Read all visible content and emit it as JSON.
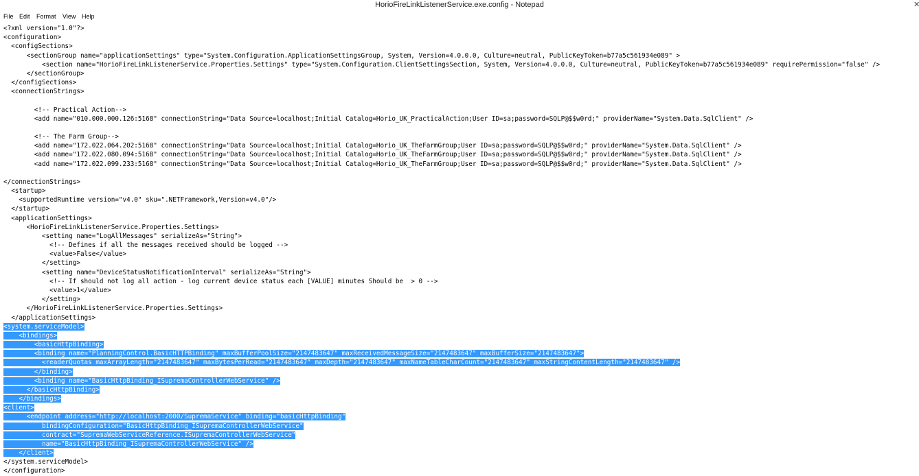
{
  "window": {
    "title": "HorioFireLinkListenerService.exe.config - Notepad"
  },
  "menu": {
    "file": "File",
    "edit": "Edit",
    "format": "Format",
    "view": "View",
    "help": "Help"
  },
  "editor": {
    "selection_color": "#3399ff",
    "lines": [
      "<?xml version=\"1.0\"?>",
      "<configuration>",
      "  <configSections>",
      "      <sectionGroup name=\"applicationSettings\" type=\"System.Configuration.ApplicationSettingsGroup, System, Version=4.0.0.0, Culture=neutral, PublicKeyToken=b77a5c561934e089\" >",
      "          <section name=\"HorioFireLinkListenerService.Properties.Settings\" type=\"System.Configuration.ClientSettingsSection, System, Version=4.0.0.0, Culture=neutral, PublicKeyToken=b77a5c561934e089\" requirePermission=\"false\" />",
      "      </sectionGroup>",
      "  </configSections>",
      "  <connectionStrings>",
      "",
      "        <!-- Practical Action-->",
      "        <add name=\"010.000.000.126:5168\" connectionString=\"Data Source=localhost;Initial Catalog=Horio_UK_PracticalAction;User ID=sa;password=SQLP@$$w0rd;\" providerName=\"System.Data.SqlClient\" />",
      "",
      "        <!-- The Farm Group-->",
      "        <add name=\"172.022.064.202:5168\" connectionString=\"Data Source=localhost;Initial Catalog=Horio_UK_TheFarmGroup;User ID=sa;password=SQLP@$$w0rd;\" providerName=\"System.Data.SqlClient\" />",
      "        <add name=\"172.022.080.094:5168\" connectionString=\"Data Source=localhost;Initial Catalog=Horio_UK_TheFarmGroup;User ID=sa;password=SQLP@$$w0rd;\" providerName=\"System.Data.SqlClient\" />",
      "        <add name=\"172.022.099.233:5168\" connectionString=\"Data Source=localhost;Initial Catalog=Horio_UK_TheFarmGroup;User ID=sa;password=SQLP@$$w0rd;\" providerName=\"System.Data.SqlClient\" />",
      "",
      "</connectionStrings>",
      "  <startup>",
      "    <supportedRuntime version=\"v4.0\" sku=\".NETFramework,Version=v4.0\"/>",
      "  </startup>",
      "  <applicationSettings>",
      "      <HorioFireLinkListenerService.Properties.Settings>",
      "          <setting name=\"LogAllMessages\" serializeAs=\"String\">",
      "            <!-- Defines if all the messages received should be logged -->",
      "            <value>False</value>",
      "          </setting>",
      "          <setting name=\"DeviceStatusNotificationInterval\" serializeAs=\"String\">",
      "            <!-- If should not log all action - log current device status each [VALUE] minutes Should be  > 0 -->",
      "            <value>1</value>",
      "          </setting>",
      "      </HorioFireLinkListenerService.Properties.Settings>",
      "  </applicationSettings>",
      "<system.serviceModel>",
      "    <bindings>",
      "        <basicHttpBinding>",
      "        <binding name=\"PlanningControl.BasicHTTPBinding\" maxBufferPoolSize=\"2147483647\" maxReceivedMessageSize=\"2147483647\" maxBufferSize=\"2147483647\">",
      "          <readerQuotas maxArrayLength=\"2147483647\" maxBytesPerRead=\"2147483647\" maxDepth=\"2147483647\" maxNameTableCharCount=\"2147483647\" maxStringContentLength=\"2147483647\" />",
      "        </binding>",
      "        <binding name=\"BasicHttpBinding_ISupremaControllerWebService\" />",
      "      </basicHttpBinding>",
      "    </bindings>",
      "<client>",
      "      <endpoint address=\"http://localhost:2000/SupremaService\" binding=\"basicHttpBinding\"",
      "          bindingConfiguration=\"BasicHttpBinding_ISupremaControllerWebService\"",
      "          contract=\"SupremaWebServiceReference.ISupremaControllerWebService\"",
      "          name=\"BasicHttpBinding_ISupremaControllerWebService\" />",
      "    </client>",
      "</system.serviceModel>",
      "</configuration>"
    ]
  }
}
